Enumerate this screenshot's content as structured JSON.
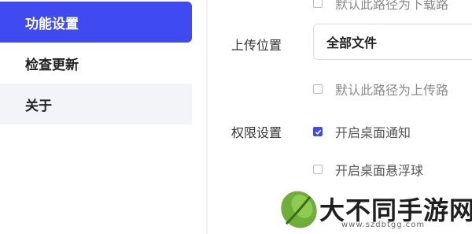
{
  "sidebar": {
    "items": [
      {
        "label": "功能设置",
        "active": true
      },
      {
        "label": "检查更新",
        "active": false
      },
      {
        "label": "关于",
        "active": false
      }
    ]
  },
  "settings": {
    "top_checkbox_label": "默认此路径为下载路",
    "upload": {
      "label": "上传位置",
      "value": "全部文件",
      "default_checkbox_label": "默认此路径为上传路"
    },
    "permissions": {
      "label": "权限设置",
      "notify_label": "开启桌面通知",
      "notify_checked": true,
      "float_label": "开启桌面悬浮球",
      "float_checked": false
    }
  },
  "watermark": {
    "text": "大不同手游网",
    "url": "www.szdbtgg.com"
  },
  "colors": {
    "accent": "#3f4bf0"
  }
}
